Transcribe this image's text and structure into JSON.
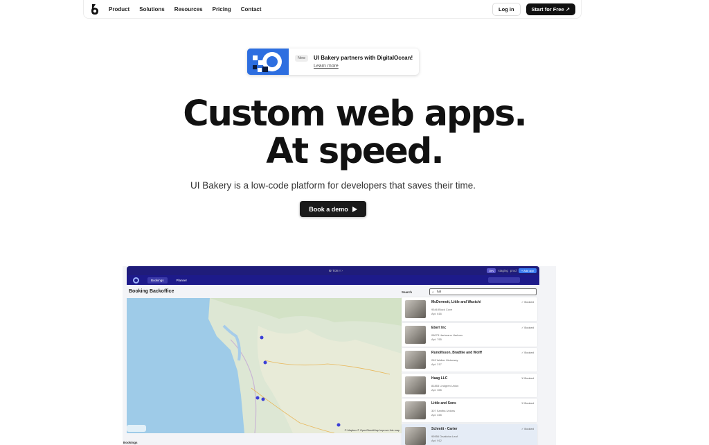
{
  "nav": {
    "links": [
      "Product",
      "Solutions",
      "Resources",
      "Pricing",
      "Contact"
    ],
    "login": "Log in",
    "start": "Start for Free ↗"
  },
  "announcement": {
    "badge": "New",
    "title": "UI Bakery partners with DigitalOcean!",
    "link": "Learn more"
  },
  "hero": {
    "title_line1": "Custom web apps.",
    "title_line2": "At speed.",
    "subtitle": "UI Bakery is a low-code platform for developers that saves their time.",
    "demo_button": "Book a demo"
  },
  "app": {
    "topbar_center": "⛁ TO8 ▿ ›",
    "topbar_right": [
      "Dev",
      "staging",
      "prod",
      "+ Add app"
    ],
    "tabs": [
      "Bookings",
      "Planner"
    ],
    "title": "Booking Backoffice",
    "search_label": "Search",
    "search_value": "hal",
    "bookings_label": "Bookings",
    "map_attrib": "© Mapbox © OpenStreetMap Improve this map",
    "items": [
      {
        "title": "McDermott, Little and Wastchi",
        "addr": "9546 Block Cove",
        "apt": "Apt. 616",
        "status": "✓ Booked"
      },
      {
        "title": "Ebert Inc",
        "addr": "08073 Hartmann Harbors",
        "apt": "Apt. 765",
        "status": "✓ Booked"
      },
      {
        "title": "Runolfsson, Bradtke and Wolff",
        "addr": "263 Walker Motorway",
        "apt": "Apt. 217",
        "status": "✓ Booked"
      },
      {
        "title": "Haag LLC",
        "addr": "81853 Lindgren Union",
        "apt": "Apt. 355",
        "status": "✕ Booked"
      },
      {
        "title": "Little and Sons",
        "addr": "307 Santha Unions",
        "apt": "Apt. 465",
        "status": "✕ Booked"
      },
      {
        "title": "Schmitt - Carter",
        "addr": "95956 Dnakicha Leaf",
        "apt": "Apt. 912",
        "status": "✓ Booked"
      }
    ]
  },
  "colors": {
    "accent_dark": "#111111",
    "app_header": "#1f1c7a",
    "announcement_image": "#2d6ee0"
  }
}
